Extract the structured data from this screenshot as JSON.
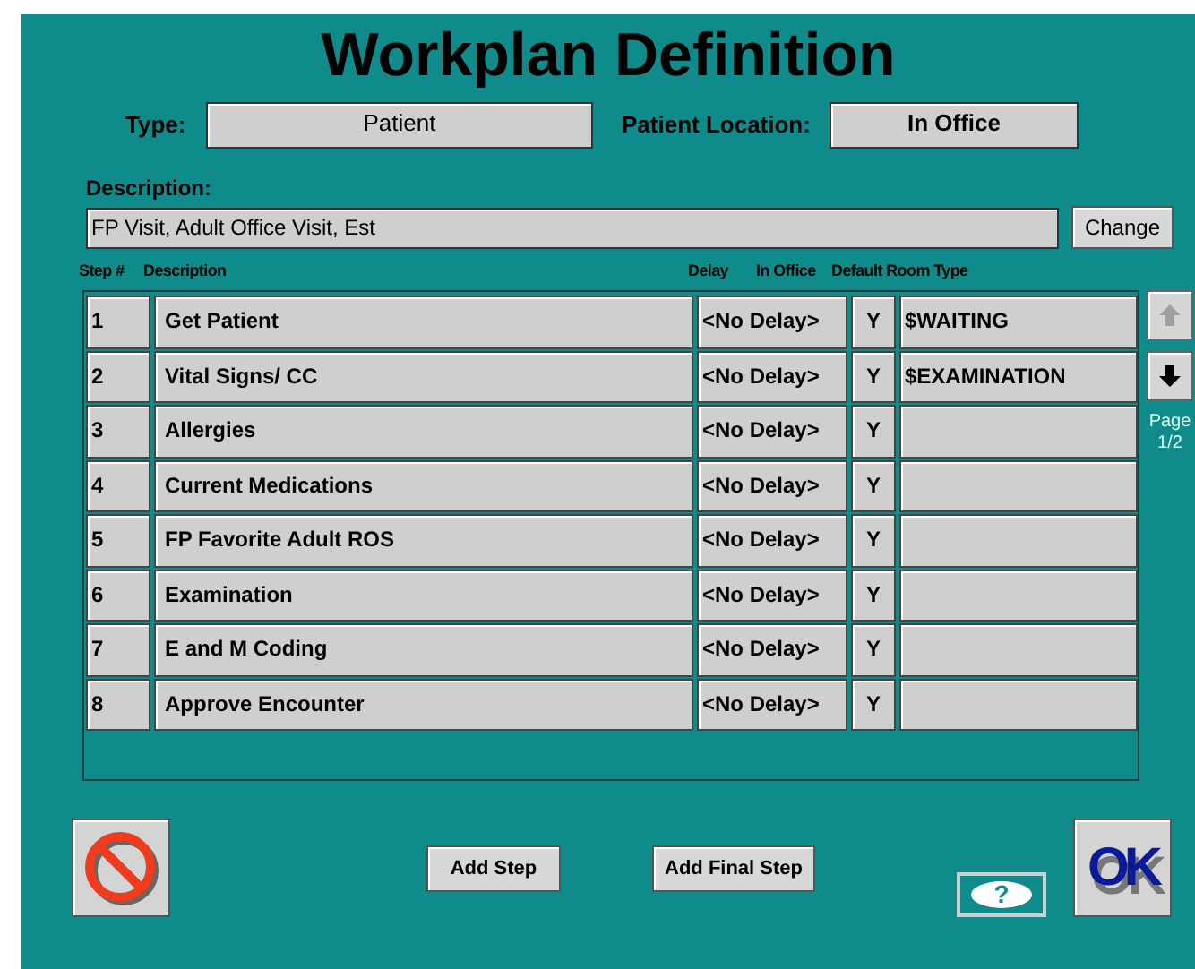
{
  "title": "Workplan Definition",
  "type": {
    "label": "Type:",
    "value": "Patient"
  },
  "patient_location": {
    "label": "Patient Location:",
    "value": "In Office"
  },
  "description": {
    "label": "Description:",
    "value": "FP Visit, Adult Office Visit, Est",
    "button": "Change"
  },
  "table": {
    "columns": [
      "Step #",
      "Description",
      "Delay",
      "In Office",
      "Default Room Type"
    ],
    "rows": [
      {
        "step": "1",
        "description": "Get Patient",
        "delay": "<No Delay>",
        "in_office": "Y",
        "room_type": "$WAITING"
      },
      {
        "step": "2",
        "description": "Vital Signs/ CC",
        "delay": "<No Delay>",
        "in_office": "Y",
        "room_type": "$EXAMINATION"
      },
      {
        "step": "3",
        "description": "Allergies",
        "delay": "<No Delay>",
        "in_office": "Y"
      },
      {
        "step": "4",
        "description": "Current Medications",
        "delay": "<No Delay>",
        "in_office": "Y"
      },
      {
        "step": "5",
        "description": "FP Favorite Adult ROS",
        "delay": "<No Delay>",
        "in_office": "Y"
      },
      {
        "step": "6",
        "description": "Examination",
        "delay": "<No Delay>",
        "in_office": "Y"
      },
      {
        "step": "7",
        "description": "E and M Coding",
        "delay": "<No Delay>",
        "in_office": "Y"
      },
      {
        "step": "8",
        "description": "Approve Encounter",
        "delay": "<No Delay>",
        "in_office": "Y"
      }
    ]
  },
  "pager": {
    "up_disabled": true,
    "down_disabled": false,
    "label": "Page",
    "page": "1/2"
  },
  "buttons": {
    "add_step": "Add Step",
    "add_final_step": "Add Final Step",
    "help": "?",
    "ok": "OK"
  }
}
